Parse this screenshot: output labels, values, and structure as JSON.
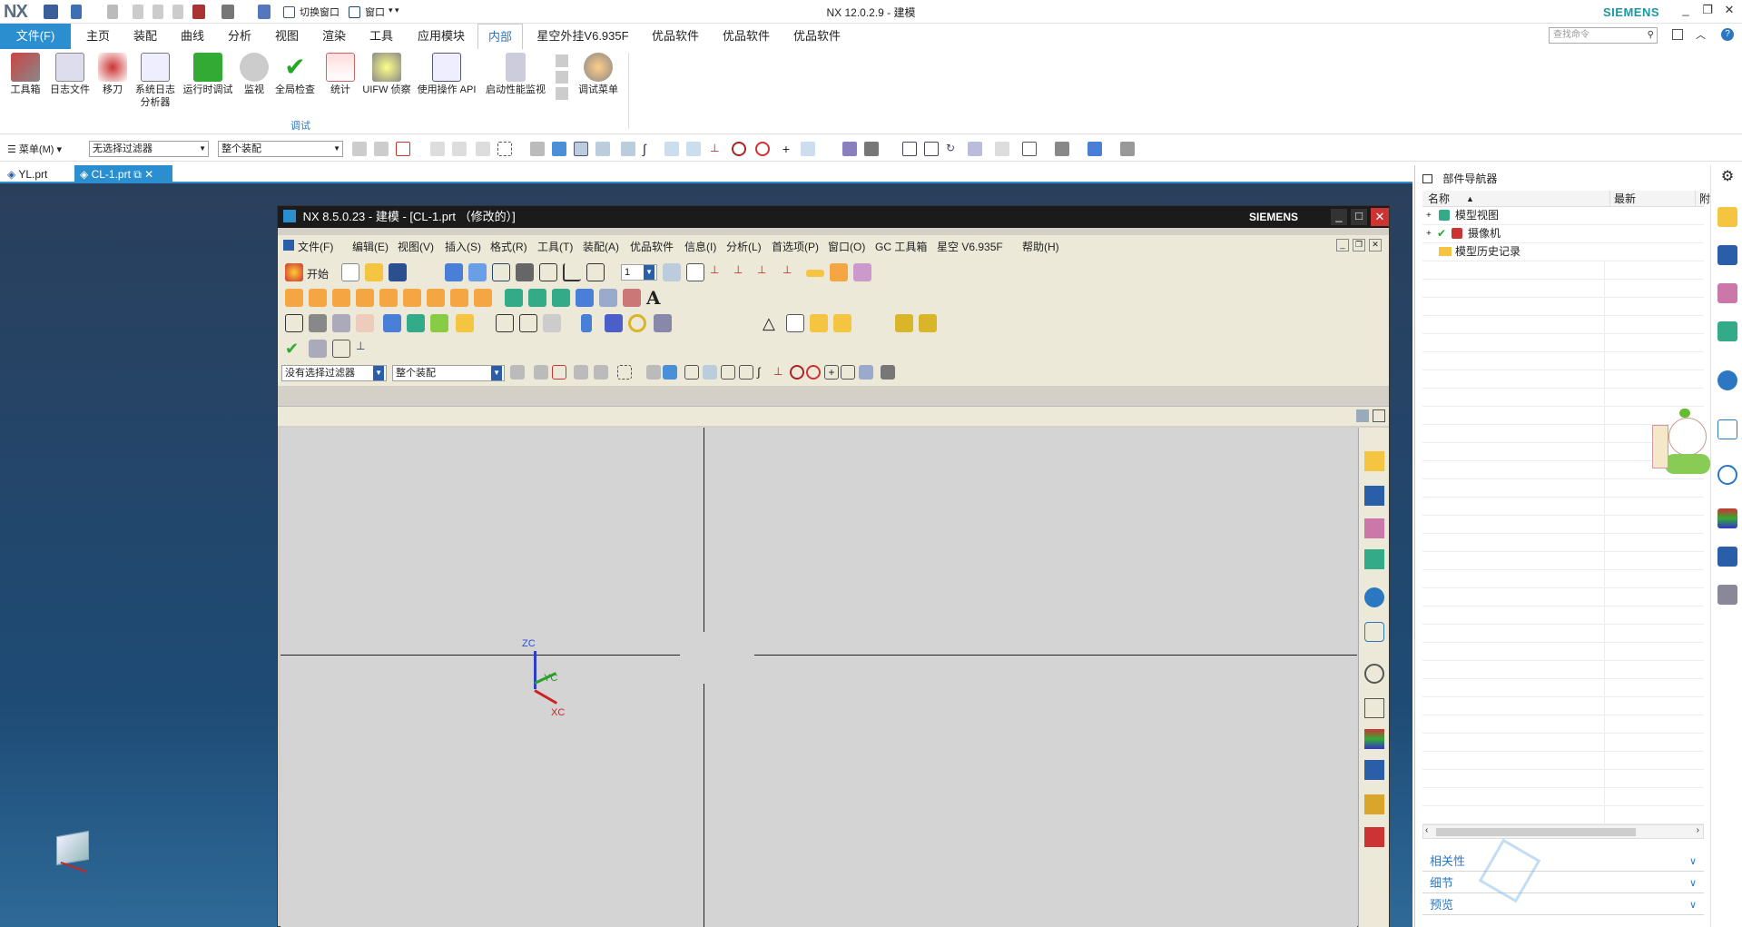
{
  "app": {
    "logo": "NX",
    "title": "NX 12.0.2.9 - 建模",
    "brand": "SIEMENS",
    "qat": {
      "switch_window": "切换窗口",
      "window": "窗口"
    }
  },
  "ribbon_tabs": [
    {
      "label": "文件(F)"
    },
    {
      "label": "主页"
    },
    {
      "label": "装配"
    },
    {
      "label": "曲线"
    },
    {
      "label": "分析"
    },
    {
      "label": "视图"
    },
    {
      "label": "渲染"
    },
    {
      "label": "工具"
    },
    {
      "label": "应用模块"
    },
    {
      "label": "内部"
    },
    {
      "label": "星空外挂V6.935F"
    },
    {
      "label": "优品软件"
    },
    {
      "label": "优品软件"
    },
    {
      "label": "优品软件"
    }
  ],
  "search": {
    "placeholder": "查找命令"
  },
  "ribbon": {
    "buttons": [
      {
        "label": "工具箱"
      },
      {
        "label": "日志文件"
      },
      {
        "label": "移刀"
      },
      {
        "label": "系统日志分析器"
      },
      {
        "label": "运行时调试"
      },
      {
        "label": "监视"
      },
      {
        "label": "全局检查"
      },
      {
        "label": "统计"
      },
      {
        "label": "UIFW 侦察"
      },
      {
        "label": "使用操作 API"
      },
      {
        "label": "启动性能监视"
      },
      {
        "label": "调试菜单"
      }
    ],
    "group_label": "调试"
  },
  "toolbar": {
    "menu": "菜单(M)",
    "filter": "无选择过滤器",
    "assembly": "整个装配"
  },
  "doc_tabs": [
    {
      "label": "YL.prt"
    },
    {
      "label": "CL-1.prt"
    }
  ],
  "inner_window": {
    "title": "NX 8.5.0.23 - 建模 - [CL-1.prt （修改的）]",
    "brand": "SIEMENS",
    "menus": [
      {
        "label": "文件(F)"
      },
      {
        "label": "编辑(E)"
      },
      {
        "label": "视图(V)"
      },
      {
        "label": "插入(S)"
      },
      {
        "label": "格式(R)"
      },
      {
        "label": "工具(T)"
      },
      {
        "label": "装配(A)"
      },
      {
        "label": "优品软件"
      },
      {
        "label": "信息(I)"
      },
      {
        "label": "分析(L)"
      },
      {
        "label": "首选项(P)"
      },
      {
        "label": "窗口(O)"
      },
      {
        "label": "GC 工具箱"
      },
      {
        "label": "星空 V6.935F"
      },
      {
        "label": "帮助(H)"
      }
    ],
    "start": "开始",
    "layer_value": "1",
    "filter": "没有选择过滤器",
    "assembly": "整个装配",
    "axes": {
      "z": "ZC",
      "y": "YC",
      "x": "XC"
    }
  },
  "navigator": {
    "title": "部件导航器",
    "columns": {
      "name": "名称",
      "latest": "最新",
      "extra": "附"
    },
    "rows": [
      {
        "label": "模型视图"
      },
      {
        "label": "摄像机"
      },
      {
        "label": "模型历史记录"
      }
    ],
    "sections": [
      {
        "label": "相关性"
      },
      {
        "label": "细节"
      },
      {
        "label": "预览"
      }
    ]
  }
}
